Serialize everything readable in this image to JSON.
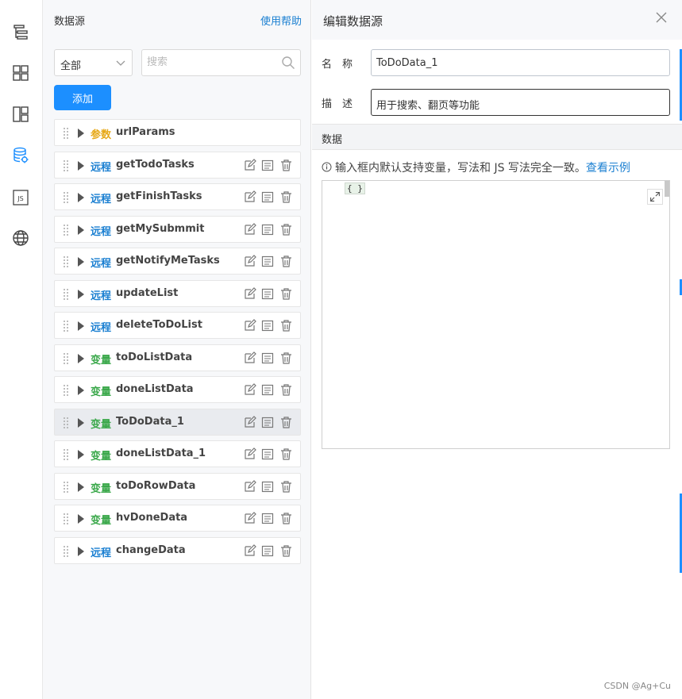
{
  "rail": {
    "icons": [
      "outline-icon",
      "components-icon",
      "layout-icon",
      "datasource-icon",
      "js-icon",
      "globe-icon"
    ],
    "active_color": "#1c8fff",
    "js_label": "JS"
  },
  "datasource": {
    "title": "数据源",
    "help": "使用帮助",
    "filter_value": "全部",
    "search_placeholder": "搜索",
    "add_label": "添加",
    "items": [
      {
        "tag": "参数",
        "name": "urlParams",
        "kind": "param"
      },
      {
        "tag": "远程",
        "name": "getTodoTasks",
        "kind": "remote"
      },
      {
        "tag": "远程",
        "name": "getFinishTasks",
        "kind": "remote"
      },
      {
        "tag": "远程",
        "name": "getMySubmmit",
        "kind": "remote"
      },
      {
        "tag": "远程",
        "name": "getNotifyMeTasks",
        "kind": "remote"
      },
      {
        "tag": "远程",
        "name": "updateList",
        "kind": "remote"
      },
      {
        "tag": "远程",
        "name": "deleteToDoList",
        "kind": "remote"
      },
      {
        "tag": "变量",
        "name": "toDoListData",
        "kind": "var"
      },
      {
        "tag": "变量",
        "name": "doneListData",
        "kind": "var"
      },
      {
        "tag": "变量",
        "name": "ToDoData_1",
        "kind": "var",
        "selected": true
      },
      {
        "tag": "变量",
        "name": "doneListData_1",
        "kind": "var"
      },
      {
        "tag": "变量",
        "name": "toDoRowData",
        "kind": "var"
      },
      {
        "tag": "变量",
        "name": "hvDoneData",
        "kind": "var"
      },
      {
        "tag": "远程",
        "name": "changeData",
        "kind": "remote"
      }
    ],
    "tag_colors": {
      "param": "#e6a817",
      "remote": "#1a7fd1",
      "var": "#3aa84a"
    }
  },
  "editor": {
    "title": "编辑数据源",
    "name_label": "名　称",
    "name_value": "ToDoData_1",
    "desc_label": "描　述",
    "desc_value": "用于搜索、翻页等功能",
    "section_label": "数据",
    "hint_text": "输入框内默认支持变量，写法和 JS 写法完全一致。",
    "hint_link": "查看示例",
    "code": "{ }"
  },
  "watermark": "CSDN @Ag+Cu"
}
